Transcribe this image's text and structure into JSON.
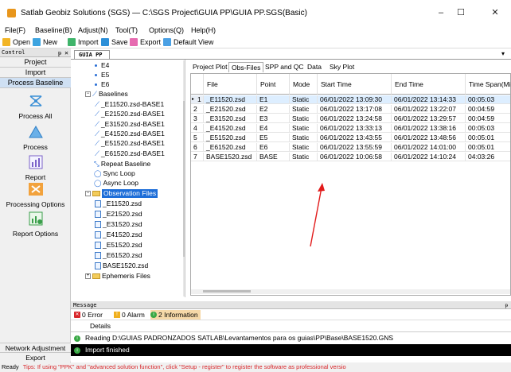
{
  "window": {
    "title": "Satlab Geobiz Solutions (SGS) — C:\\SGS Project\\GUIA PP\\GUIA PP.SGS(Basic)",
    "minimize": "–",
    "maximize": "☐",
    "close": "✕"
  },
  "menu": [
    {
      "label": "File(F)"
    },
    {
      "label": "Baseline(B)"
    },
    {
      "label": "Adjust(N)"
    },
    {
      "label": "Tool(T)"
    },
    {
      "label": "Options(Q)"
    },
    {
      "label": "Help(H)"
    }
  ],
  "toolbar": {
    "open": "Open",
    "new": "New",
    "import": "Import",
    "save": "Save",
    "export": "Export",
    "default_view": "Default View"
  },
  "left_panel": {
    "header": "Control",
    "pin": "ᵽ",
    "close": "✕",
    "nav": [
      "Project",
      "Import",
      "Process Baseline"
    ],
    "actions": [
      {
        "label": "Process All",
        "icon": "process-all-icon"
      },
      {
        "label": "Process",
        "icon": "process-icon"
      },
      {
        "label": "Report",
        "icon": "report-icon"
      },
      {
        "label": "Processing Options",
        "icon": "processing-options-icon"
      },
      {
        "label": "Report Options",
        "icon": "report-options-icon"
      }
    ],
    "bottom": [
      "Network Adjustment",
      "Export"
    ]
  },
  "document_tab": {
    "label": "GUIA PP"
  },
  "tree": {
    "points": [
      "E4",
      "E5",
      "E6"
    ],
    "baselines_label": "Baselines",
    "baselines": [
      "_E11520.zsd-BASE1",
      "_E21520.zsd-BASE1",
      "_E31520.zsd-BASE1",
      "_E41520.zsd-BASE1",
      "_E51520.zsd-BASE1",
      "_E61520.zsd-BASE1"
    ],
    "repeat_baseline": "Repeat Baseline",
    "sync_loop": "Sync Loop",
    "async_loop": "Async Loop",
    "observation_files_label": "Observation Files",
    "observation_files": [
      "_E11520.zsd",
      "_E21520.zsd",
      "_E31520.zsd",
      "_E41520.zsd",
      "_E51520.zsd",
      "_E61520.zsd",
      "BASE1520.zsd"
    ],
    "ephemeris_files": "Ephemeris Files"
  },
  "grid_tabs": [
    "Project Plot",
    "Obs-Files",
    "SPP and QC",
    "Data",
    "Sky Plot"
  ],
  "grid": {
    "columns": [
      "File",
      "Point",
      "Mode",
      "Start Time",
      "End Time",
      "Time Span(Min"
    ],
    "rows": [
      {
        "num": "1",
        "file": "_E11520.zsd",
        "point": "E1",
        "mode": "Static",
        "start": "06/01/2022 13:09:30",
        "end": "06/01/2022 13:14:33",
        "span": "00:05:03"
      },
      {
        "num": "2",
        "file": "_E21520.zsd",
        "point": "E2",
        "mode": "Static",
        "start": "06/01/2022 13:17:08",
        "end": "06/01/2022 13:22:07",
        "span": "00:04:59"
      },
      {
        "num": "3",
        "file": "_E31520.zsd",
        "point": "E3",
        "mode": "Static",
        "start": "06/01/2022 13:24:58",
        "end": "06/01/2022 13:29:57",
        "span": "00:04:59"
      },
      {
        "num": "4",
        "file": "_E41520.zsd",
        "point": "E4",
        "mode": "Static",
        "start": "06/01/2022 13:33:13",
        "end": "06/01/2022 13:38:16",
        "span": "00:05:03"
      },
      {
        "num": "5",
        "file": "_E51520.zsd",
        "point": "E5",
        "mode": "Static",
        "start": "06/01/2022 13:43:55",
        "end": "06/01/2022 13:48:56",
        "span": "00:05:01"
      },
      {
        "num": "6",
        "file": "_E61520.zsd",
        "point": "E6",
        "mode": "Static",
        "start": "06/01/2022 13:55:59",
        "end": "06/01/2022 14:01:00",
        "span": "00:05:01"
      },
      {
        "num": "7",
        "file": "BASE1520.zsd",
        "point": "BASE",
        "mode": "Static",
        "start": "06/01/2022 10:06:58",
        "end": "06/01/2022 14:10:24",
        "span": "04:03:26"
      }
    ]
  },
  "messages": {
    "header": "Message",
    "pin": "ᵽ",
    "error": "0 Error",
    "alarm": "0 Alarm",
    "info": "2 Information",
    "details_col": "Details",
    "rows": [
      {
        "text": "Reading  D:\\GUIAS PADRONZADOS SATLAB\\Levantamentos para os guias\\PP\\Base\\BASE1520.GNS"
      },
      {
        "text": "Import finished"
      }
    ]
  },
  "status": {
    "ready": "Ready",
    "tips": "Tips: If using \"PPK\" and \"advanced solution function\", click \"Setup - register\" to register the software as professional versio"
  },
  "colors": {
    "accent": "#1e6ed8",
    "selected_bg": "#cfe0f3",
    "tips_red": "#d8262a",
    "arrow_red": "#e21b1b"
  }
}
